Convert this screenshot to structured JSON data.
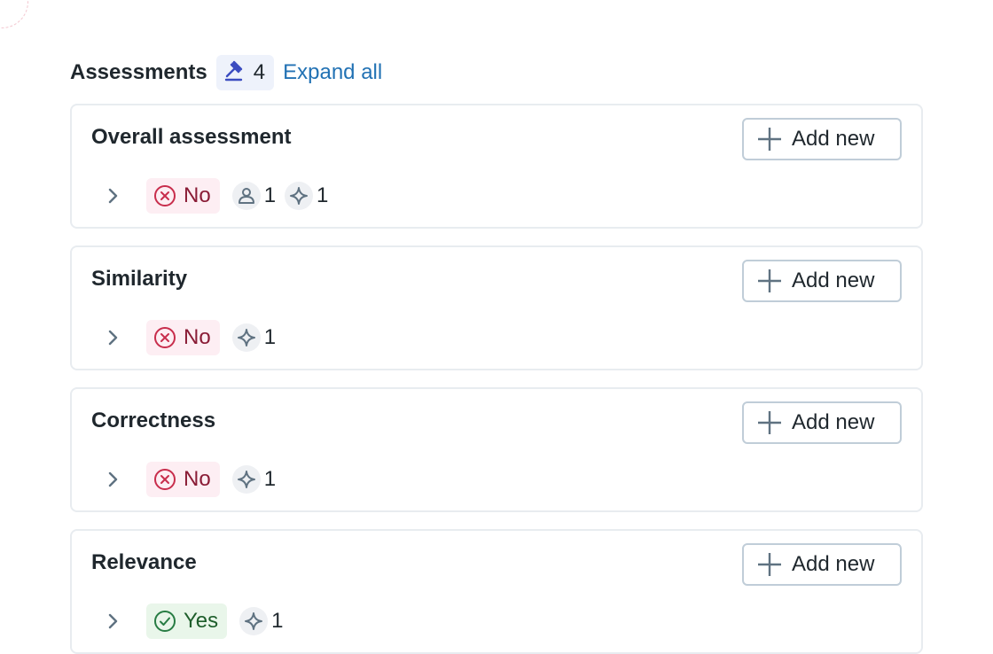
{
  "header": {
    "title": "Assessments",
    "count": "4",
    "expand_label": "Expand all"
  },
  "add_label": "Add new",
  "cards": [
    {
      "title": "Overall assessment",
      "verdict": "No",
      "human_count": "1",
      "ai_count": "1"
    },
    {
      "title": "Similarity",
      "verdict": "No",
      "ai_count": "1"
    },
    {
      "title": "Correctness",
      "verdict": "No",
      "ai_count": "1"
    },
    {
      "title": "Relevance",
      "verdict": "Yes",
      "ai_count": "1"
    }
  ],
  "colors": {
    "link": "#2272b4",
    "no_bg": "#fdeef3",
    "no_icon": "#c82d4c",
    "yes_bg": "#e9f6ea",
    "yes_icon": "#277c43"
  }
}
